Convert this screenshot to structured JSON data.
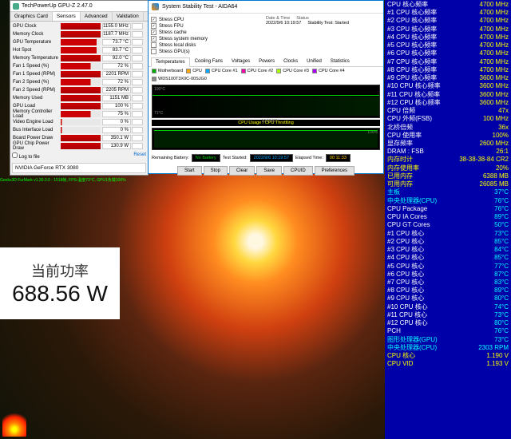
{
  "gpuz": {
    "title": "TechPowerUp GPU-Z 2.47.0",
    "tabs": [
      "Graphics Card",
      "Sensors",
      "Advanced",
      "Validation"
    ],
    "rows": [
      {
        "label": "GPU Clock",
        "value": "1155.0 MHz",
        "bar": "p100"
      },
      {
        "label": "Memory Clock",
        "value": "1187.7 MHz",
        "bar": "p100"
      },
      {
        "label": "GPU Temperature",
        "value": "73.7 °C",
        "bar": "p90"
      },
      {
        "label": "Hot Spot",
        "value": "83.7 °C",
        "bar": "p90"
      },
      {
        "label": "Memory Temperature",
        "value": "92.0 °C",
        "bar": "p100"
      },
      {
        "label": "Fan 1 Speed (%)",
        "value": "72 %",
        "bar": "p75"
      },
      {
        "label": "Fan 1 Speed (RPM)",
        "value": "2201 RPM",
        "bar": "p100"
      },
      {
        "label": "Fan 2 Speed (%)",
        "value": "72 %",
        "bar": "p75"
      },
      {
        "label": "Fan 2 Speed (RPM)",
        "value": "2205 RPM",
        "bar": "p100"
      },
      {
        "label": "Memory Used",
        "value": "1151 MB",
        "bar": "p100"
      },
      {
        "label": "GPU Load",
        "value": "100 %",
        "bar": "p100"
      },
      {
        "label": "Memory Controller Load",
        "value": "75 %",
        "bar": "p75"
      },
      {
        "label": "Video Engine Load",
        "value": "0 %",
        "bar": "p1"
      },
      {
        "label": "Bus Interface Load",
        "value": "0 %",
        "bar": "p1"
      },
      {
        "label": "Board Power Draw",
        "value": "350.1 W",
        "bar": "p100"
      },
      {
        "label": "GPU Chip Power Draw",
        "value": "130.9 W",
        "bar": "p100"
      }
    ],
    "logToFile": "Log to file",
    "reset": "Reset",
    "card": "NVIDIA GeForce RTX 3080"
  },
  "aida": {
    "title": "System Stability Test - AIDA64",
    "checks": [
      "Stress CPU",
      "Stress FPU",
      "Stress cache",
      "Stress system memory",
      "Stress local disks",
      "Stress GPU(s)"
    ],
    "col2": {
      "dateTime": "Date & Time",
      "status": "Status",
      "dt": "2022/9/6 10:19:57",
      "st": "Stability Test: Started"
    },
    "tabs": [
      "Temperatures",
      "Cooling Fans",
      "Voltages",
      "Powers",
      "Clocks",
      "Unified",
      "Statistics"
    ],
    "legend": [
      "Motherboard",
      "CPU",
      "CPU Core #1",
      "CPU Core #2",
      "CPU Core #3",
      "CPU Core #4",
      "WDS100T3X0C-00SJG0"
    ],
    "chart1": {
      "y1": "100°C",
      "y2": "71°C",
      "x": "10:19:57"
    },
    "chart2Title": "CPU Usage / CPU Throttling",
    "chart2": {
      "y": "100%"
    },
    "bottom": {
      "battLbl": "Remaining Battery:",
      "batt": "No Battery",
      "startLbl": "Test Started:",
      "start": "2022/9/6 10:19:57",
      "elapLbl": "Elapsed Time:",
      "elap": "00:11:33"
    },
    "btns": [
      "Start",
      "Stop",
      "Clear",
      "Save",
      "CPUID",
      "Preferences"
    ]
  },
  "power": {
    "label": "当前功率",
    "value": "688.56 W"
  },
  "furmark": "Geeks3D FurMark v1.30.0.0 - 1518帧, FPS:温度73°C, GPU1负载100%",
  "sidebar": [
    {
      "l": "CPU 核心频率",
      "v": "4700 MHz"
    },
    {
      "l": "#1 CPU 核心频率",
      "v": "4700 MHz"
    },
    {
      "l": "#2 CPU 核心频率",
      "v": "4700 MHz"
    },
    {
      "l": "#3 CPU 核心频率",
      "v": "4700 MHz"
    },
    {
      "l": "#4 CPU 核心频率",
      "v": "4700 MHz"
    },
    {
      "l": "#5 CPU 核心频率",
      "v": "4700 MHz"
    },
    {
      "l": "#6 CPU 核心频率",
      "v": "4700 MHz"
    },
    {
      "l": "#7 CPU 核心频率",
      "v": "4700 MHz"
    },
    {
      "l": "#8 CPU 核心频率",
      "v": "4700 MHz"
    },
    {
      "l": "#9 CPU 核心频率",
      "v": "3600 MHz"
    },
    {
      "l": "#10 CPU 核心频率",
      "v": "3600 MHz"
    },
    {
      "l": "#11 CPU 核心频率",
      "v": "3600 MHz"
    },
    {
      "l": "#12 CPU 核心频率",
      "v": "3600 MHz"
    },
    {
      "l": "CPU 倍频",
      "v": "47x"
    },
    {
      "l": "CPU 外频(FSB)",
      "v": "100 MHz"
    },
    {
      "l": "北桥倍频",
      "v": "36x"
    },
    {
      "l": "CPU 使用率",
      "v": "100%"
    },
    {
      "l": "显存频率",
      "v": "2600 MHz"
    },
    {
      "l": "DRAM : FSB",
      "v": "26:1"
    },
    {
      "l": "内存时计",
      "v": "38-38-38-84 CR2",
      "lc": "y"
    },
    {
      "l": "内存使用率",
      "v": "20%",
      "lc": "y"
    },
    {
      "l": "已用内存",
      "v": "6388 MB",
      "lc": "y"
    },
    {
      "l": "可用内存",
      "v": "26085 MB",
      "lc": "y"
    },
    {
      "l": "主板",
      "v": "37°C",
      "lc": "c",
      "vc": "c"
    },
    {
      "l": "中央处理器(CPU)",
      "v": "76°C",
      "lc": "c",
      "vc": "c"
    },
    {
      "l": "CPU Package",
      "v": "76°C",
      "vc": "c"
    },
    {
      "l": "CPU IA Cores",
      "v": "89°C",
      "vc": "c"
    },
    {
      "l": "CPU GT Cores",
      "v": "50°C",
      "vc": "c"
    },
    {
      "l": "#1 CPU 核心",
      "v": "73°C",
      "vc": "c"
    },
    {
      "l": "#2 CPU 核心",
      "v": "85°C",
      "vc": "c"
    },
    {
      "l": "#3 CPU 核心",
      "v": "84°C",
      "vc": "c"
    },
    {
      "l": "#4 CPU 核心",
      "v": "85°C",
      "vc": "c"
    },
    {
      "l": "#5 CPU 核心",
      "v": "77°C",
      "vc": "c"
    },
    {
      "l": "#6 CPU 核心",
      "v": "87°C",
      "vc": "c"
    },
    {
      "l": "#7 CPU 核心",
      "v": "83°C",
      "vc": "c"
    },
    {
      "l": "#8 CPU 核心",
      "v": "89°C",
      "vc": "c"
    },
    {
      "l": "#9 CPU 核心",
      "v": "80°C",
      "vc": "c"
    },
    {
      "l": "#10 CPU 核心",
      "v": "74°C",
      "vc": "c"
    },
    {
      "l": "#11 CPU 核心",
      "v": "73°C",
      "vc": "c"
    },
    {
      "l": "#12 CPU 核心",
      "v": "80°C",
      "vc": "c"
    },
    {
      "l": "PCH",
      "v": "76°C",
      "vc": "c"
    },
    {
      "l": "图形处理器(GPU)",
      "v": "73°C",
      "lc": "c",
      "vc": "c"
    },
    {
      "l": "中央处理器(CPU)",
      "v": "2303 RPM",
      "lc": "c",
      "vc": "c"
    },
    {
      "l": "CPU 核心",
      "v": "1.190 V",
      "lc": "y"
    },
    {
      "l": "CPU VID",
      "v": "1.193 V",
      "lc": "y"
    }
  ]
}
